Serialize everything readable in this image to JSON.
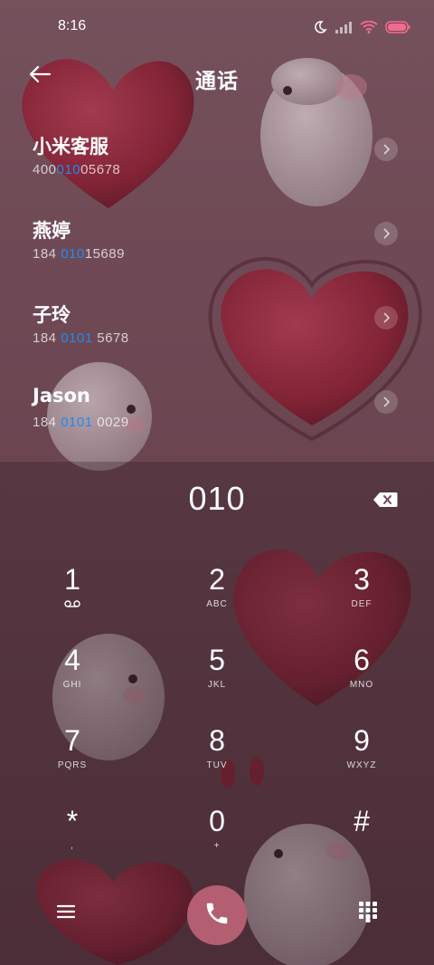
{
  "status_bar": {
    "time": "8:16"
  },
  "header": {
    "title": "通话"
  },
  "contacts": [
    {
      "name": "小米客服",
      "number_pre": "400",
      "number_match": "010",
      "number_post": "05678"
    },
    {
      "name": "燕婷",
      "number_pre": "184 ",
      "number_match": "010",
      "number_post": "15689"
    },
    {
      "name": "子玲",
      "number_pre": "184 ",
      "number_match": "0101",
      "number_post": " 5678"
    },
    {
      "name": "Jason",
      "number_pre": "184 ",
      "number_match": "0101",
      "number_post": " 0029"
    }
  ],
  "dialer": {
    "entered_number": "010"
  },
  "keypad": [
    {
      "digit": "1",
      "letters": ""
    },
    {
      "digit": "2",
      "letters": "ABC"
    },
    {
      "digit": "3",
      "letters": "DEF"
    },
    {
      "digit": "4",
      "letters": "GHI"
    },
    {
      "digit": "5",
      "letters": "JKL"
    },
    {
      "digit": "6",
      "letters": "MNO"
    },
    {
      "digit": "7",
      "letters": "PQRS"
    },
    {
      "digit": "8",
      "letters": "TUV"
    },
    {
      "digit": "9",
      "letters": "WXYZ"
    },
    {
      "digit": "*",
      "letters": ","
    },
    {
      "digit": "0",
      "letters": "+"
    },
    {
      "digit": "#",
      "letters": ""
    }
  ],
  "colors": {
    "accent_match": "#1f8cf0",
    "call_button": "#b45e72",
    "battery": "#f06b8f"
  },
  "icons": {
    "back": "back-arrow-icon",
    "delete": "backspace-icon",
    "menu": "menu-icon",
    "call": "phone-icon",
    "keypad": "dialpad-icon",
    "voicemail": "voicemail-icon"
  }
}
